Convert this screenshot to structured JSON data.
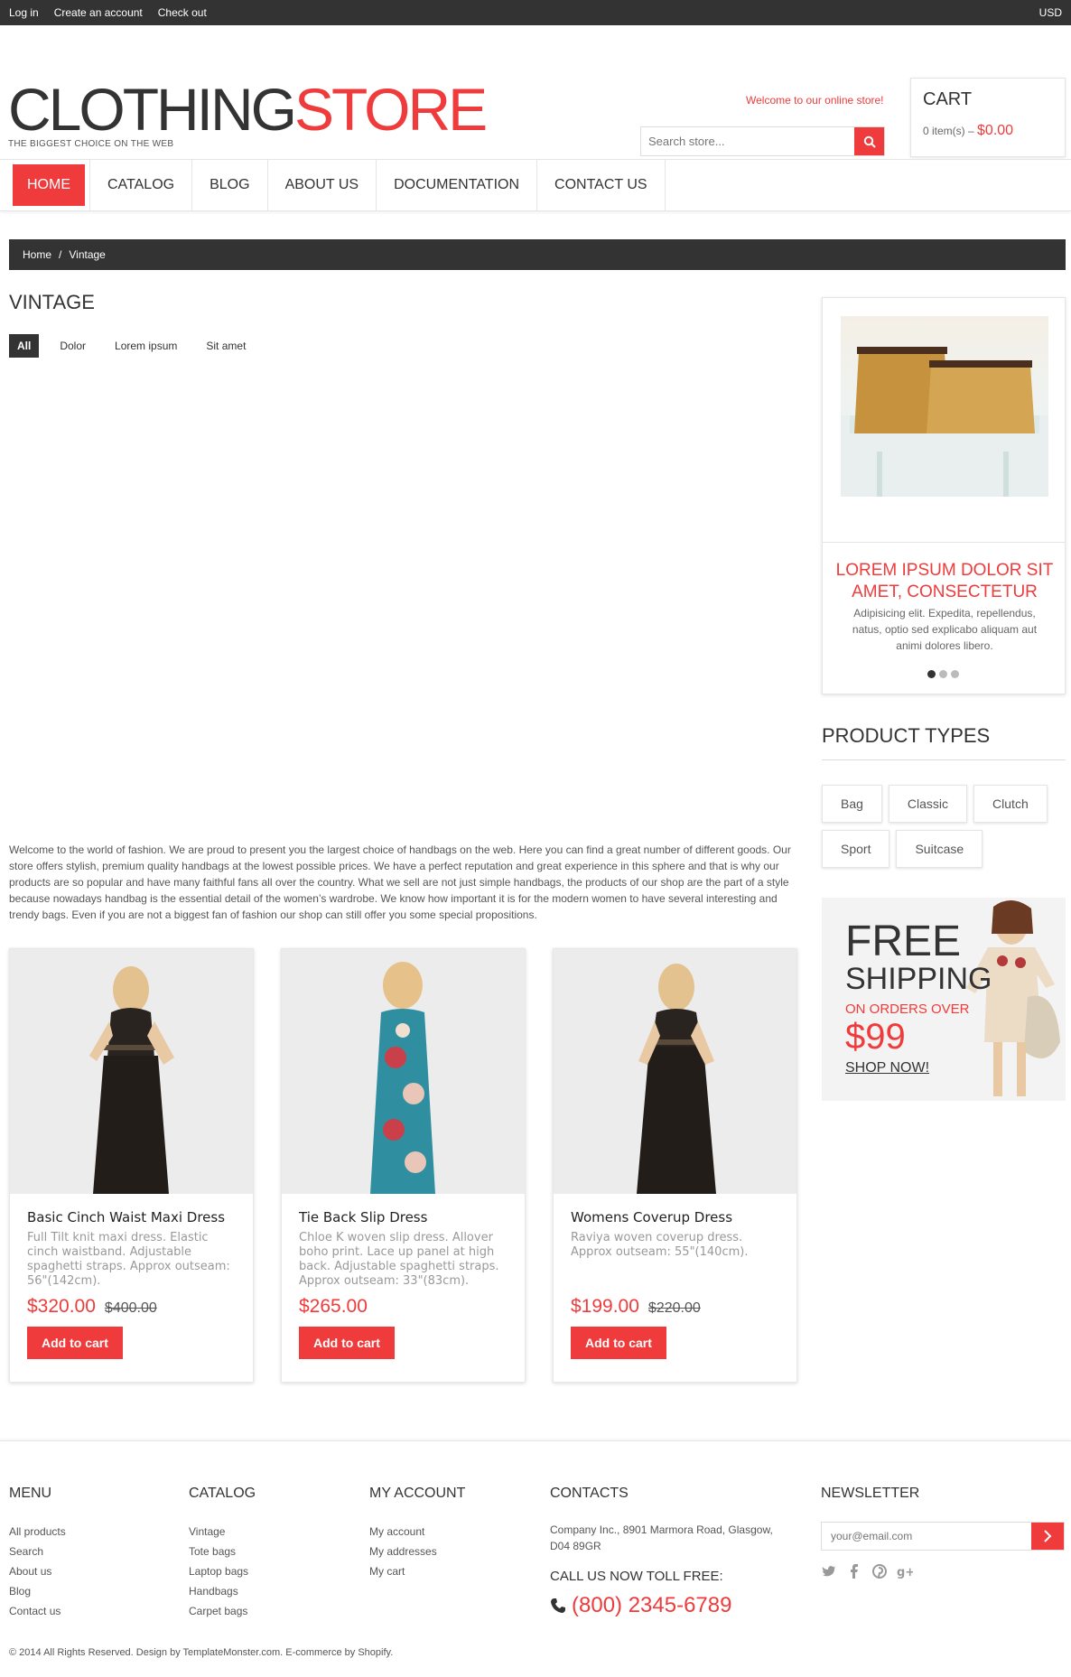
{
  "topbar": {
    "login": "Log in",
    "create": "Create an account",
    "checkout": "Check out",
    "currency": "USD"
  },
  "header": {
    "logo_part1": "CLOTHING",
    "logo_part2": "STORE",
    "tagline": "THE BIGGEST CHOICE ON THE WEB",
    "welcome": "Welcome to our online store!",
    "search_placeholder": "Search store...",
    "cart_title": "CART",
    "cart_items": "0 item(s) –",
    "cart_total": "$0.00"
  },
  "nav": {
    "home": "HOME",
    "catalog": "CATALOG",
    "blog": "BLOG",
    "about": "ABOUT US",
    "docs": "DOCUMENTATION",
    "contact": "CONTACT US"
  },
  "breadcrumb": {
    "home": "Home",
    "sep": "/",
    "current": "Vintage"
  },
  "main": {
    "title": "VINTAGE",
    "filters": [
      "All",
      "Dolor",
      "Lorem ipsum",
      "Sit amet"
    ],
    "intro": "Welcome to the world of fashion. We are proud to present you the largest choice of handbags on the web. Here you can find a great number of different goods. Our store offers stylish, premium quality handbags at the lowest possible prices. We have a perfect reputation and great experience in this sphere and that is why our products are so popular and have many faithful fans all over the country. What we sell are not just simple handbags, the products of our shop are the part of a style because nowadays handbag is the essential detail of the women’s wardrobe. We know how important it is for the modern women to have several interesting and trendy bags. Even if you are not a biggest fan of fashion our shop can still offer you some special propositions."
  },
  "products": [
    {
      "name": "Basic Cinch Waist Maxi Dress",
      "desc": "Full Tilt knit maxi dress. Elastic cinch waistband. Adjustable spaghetti straps. Approx outseam: 56\"(142cm).",
      "price": "$320.00",
      "old": "$400.00",
      "button": "Add to cart"
    },
    {
      "name": "Tie Back Slip Dress",
      "desc": "Chloe K woven slip dress. Allover boho print. Lace up panel at high back. Adjustable spaghetti straps. Approx outseam: 33\"(83cm).",
      "price": "$265.00",
      "old": "",
      "button": "Add to cart"
    },
    {
      "name": "Womens Coverup Dress",
      "desc": "Raviya woven coverup dress. Approx outseam: 55\"(140cm).",
      "price": "$199.00",
      "old": "$220.00",
      "button": "Add to cart"
    }
  ],
  "sidebar": {
    "promo_title": "LOREM IPSUM DOLOR SIT AMET, CONSECTETUR",
    "promo_text": "Adipisicing elit. Expedita, repellendus, natus, optio sed explicabo aliquam aut animi dolores libero.",
    "types_title": "PRODUCT TYPES",
    "types": [
      "Bag",
      "Classic",
      "Clutch",
      "Sport",
      "Suitcase"
    ],
    "ship_line1": "FREE",
    "ship_line2": "SHIPPING",
    "ship_line3": "ON ORDERS OVER",
    "ship_price": "$99",
    "ship_cta": "SHOP NOW!"
  },
  "footer": {
    "menu_title": "MENU",
    "menu": [
      "All products",
      "Search",
      "About us",
      "Blog",
      "Contact us"
    ],
    "catalog_title": "CATALOG",
    "catalog": [
      "Vintage",
      "Tote bags",
      "Laptop bags",
      "Handbags",
      "Carpet bags"
    ],
    "account_title": "MY ACCOUNT",
    "account": [
      "My account",
      "My addresses",
      "My cart"
    ],
    "contacts_title": "CONTACTS",
    "address": "Company Inc., 8901 Marmora Road, Glasgow, D04 89GR",
    "tollfree": "CALL US NOW TOLL FREE:",
    "phone": "(800) 2345-6789",
    "newsletter_title": "NEWSLETTER",
    "newsletter_placeholder": "your@email.com",
    "copyright": "© 2014 All Rights Reserved. Design by TemplateMonster.com. E-commerce by Shopify."
  },
  "colors": {
    "accent": "#ef3b3b",
    "dark": "#333333"
  }
}
